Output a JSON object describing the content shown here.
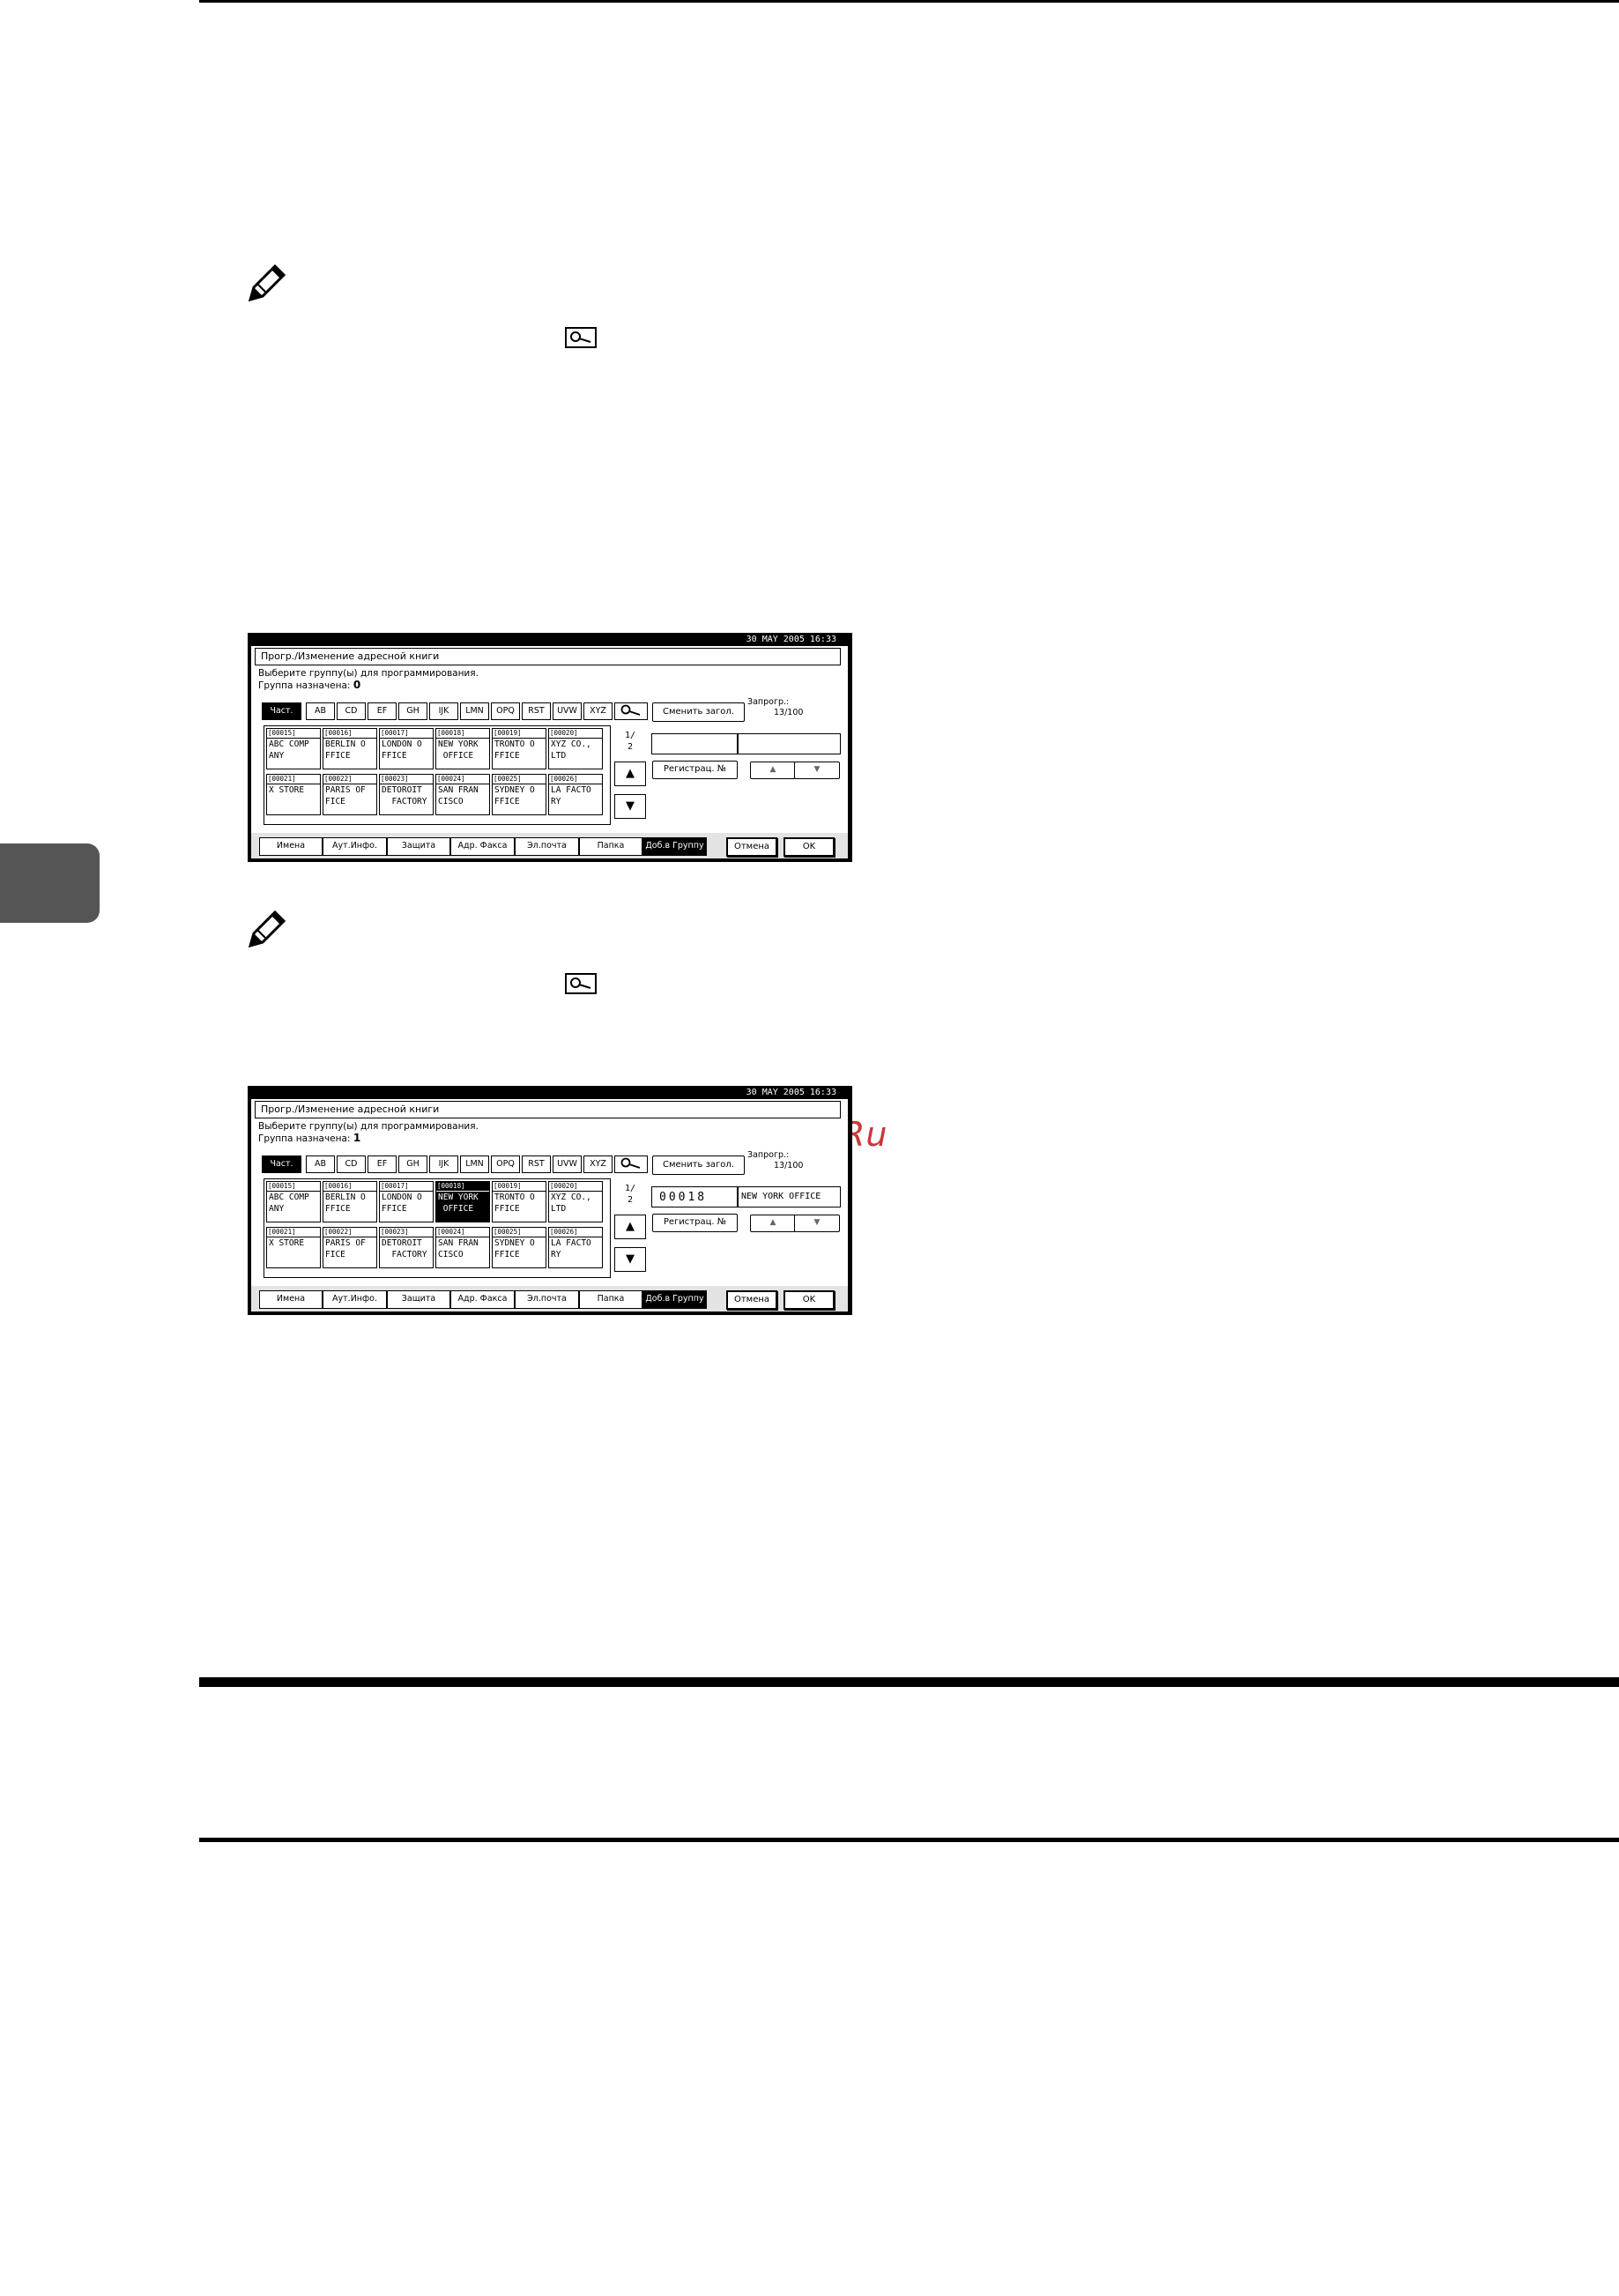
{
  "page": {
    "watermark": "McGrp.Ru"
  },
  "panels": [
    {
      "clock": "30 MAY  2005 16:33",
      "title": "Прогр./Изменение адресной книги",
      "instruction": "Выберите группу(ы) для программирования.",
      "assigned_label": "Группа назначена:",
      "assigned_count": "0",
      "tabs": [
        "Част.",
        "AB",
        "CD",
        "EF",
        "GH",
        "IJK",
        "LMN",
        "OPQ",
        "RST",
        "UVW",
        "XYZ"
      ],
      "change_title_label": "Сменить загол.",
      "quota_label": "Запрогр.:",
      "quota_value": "13/100",
      "page_indicator_top": "1/",
      "page_indicator_bottom": "2",
      "up_arrow": "▲",
      "down_arrow": "▼",
      "reg_no_label": "Регистрац. №",
      "small_up": "▲",
      "small_down": "▼",
      "dest_code": "",
      "dest_name": "",
      "entries": [
        {
          "num": "[00015]",
          "l1": "ABC COMP",
          "l2": "ANY"
        },
        {
          "num": "[00016]",
          "l1": "BERLIN O",
          "l2": "FFICE"
        },
        {
          "num": "[00017]",
          "l1": "LONDON O",
          "l2": "FFICE"
        },
        {
          "num": "[00018]",
          "l1": "NEW YORK",
          "l2": " OFFICE"
        },
        {
          "num": "[00019]",
          "l1": "TRONTO O",
          "l2": "FFICE"
        },
        {
          "num": "[00020]",
          "l1": "XYZ CO.,",
          "l2": "LTD"
        },
        {
          "num": "[00021]",
          "l1": "X STORE",
          "l2": ""
        },
        {
          "num": "[00022]",
          "l1": "PARIS OF",
          "l2": "FICE"
        },
        {
          "num": "[00023]",
          "l1": "DETOROIT",
          "l2": "  FACTORY"
        },
        {
          "num": "[00024]",
          "l1": "SAN FRAN",
          "l2": "CISCO"
        },
        {
          "num": "[00025]",
          "l1": "SYDNEY O",
          "l2": "FFICE"
        },
        {
          "num": "[00026]",
          "l1": "LA FACTO",
          "l2": "RY"
        }
      ],
      "bottom_tabs": [
        "Имена",
        "Аут.Инфо.",
        "Защита",
        "Адр. Факса",
        "Эл.почта",
        "Папка",
        "Доб.в Группу"
      ],
      "cancel_label": "Отмена",
      "ok_label": "OK"
    },
    {
      "clock": "30 MAY  2005 16:33",
      "title": "Прогр./Изменение адресной книги",
      "instruction": "Выберите группу(ы) для программирования.",
      "assigned_label": "Группа назначена:",
      "assigned_count": "1",
      "tabs": [
        "Част.",
        "AB",
        "CD",
        "EF",
        "GH",
        "IJK",
        "LMN",
        "OPQ",
        "RST",
        "UVW",
        "XYZ"
      ],
      "change_title_label": "Сменить загол.",
      "quota_label": "Запрогр.:",
      "quota_value": "13/100",
      "page_indicator_top": "1/",
      "page_indicator_bottom": "2",
      "up_arrow": "▲",
      "down_arrow": "▼",
      "reg_no_label": "Регистрац. №",
      "small_up": "▲",
      "small_down": "▼",
      "dest_code": "00018",
      "dest_name": "NEW YORK OFFICE",
      "entries": [
        {
          "num": "[00015]",
          "l1": "ABC COMP",
          "l2": "ANY"
        },
        {
          "num": "[00016]",
          "l1": "BERLIN O",
          "l2": "FFICE"
        },
        {
          "num": "[00017]",
          "l1": "LONDON O",
          "l2": "FFICE"
        },
        {
          "num": "[00018]",
          "l1": "NEW YORK",
          "l2": " OFFICE"
        },
        {
          "num": "[00019]",
          "l1": "TRONTO O",
          "l2": "FFICE"
        },
        {
          "num": "[00020]",
          "l1": "XYZ CO.,",
          "l2": "LTD"
        },
        {
          "num": "[00021]",
          "l1": "X STORE",
          "l2": ""
        },
        {
          "num": "[00022]",
          "l1": "PARIS OF",
          "l2": "FICE"
        },
        {
          "num": "[00023]",
          "l1": "DETOROIT",
          "l2": "  FACTORY"
        },
        {
          "num": "[00024]",
          "l1": "SAN FRAN",
          "l2": "CISCO"
        },
        {
          "num": "[00025]",
          "l1": "SYDNEY O",
          "l2": "FFICE"
        },
        {
          "num": "[00026]",
          "l1": "LA FACTO",
          "l2": "RY"
        }
      ],
      "bottom_tabs": [
        "Имена",
        "Аут.Инфо.",
        "Защита",
        "Адр. Факса",
        "Эл.почта",
        "Папка",
        "Доб.в Группу"
      ],
      "cancel_label": "Отмена",
      "ok_label": "OK"
    }
  ]
}
